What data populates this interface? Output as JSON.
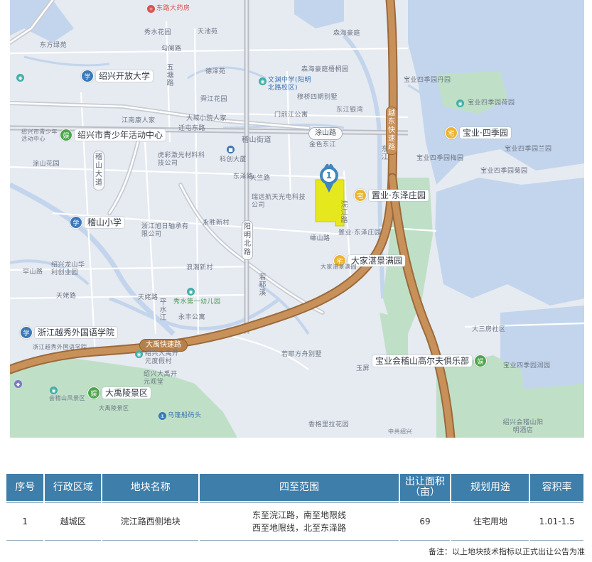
{
  "map": {
    "marker_number": "1",
    "colors": {
      "highway": "#b88049",
      "water": "#c3d5ec",
      "green": "#bfe0c7",
      "parcel": "#e6e81e",
      "marker": "#3f86bd"
    },
    "road_pills": {
      "tushan": "涂山路",
      "dayu": "大禹快速路"
    },
    "vertical_road_pills": {
      "yangming": "阳明北路",
      "yuedong": "越东快速路",
      "jishan": "稽山大道"
    },
    "poi": {
      "kaifang": {
        "icon": "education-icon",
        "text": "绍兴开放大学"
      },
      "youth": {
        "icon": "entertainment-icon",
        "text": "绍兴市青少年活动中心"
      },
      "baoye_siji": {
        "icon": "residential-icon",
        "text": "宝业·四季园"
      },
      "dongze": {
        "icon": "residential-icon",
        "text": "置业·东泽庄园"
      },
      "jishan_school": {
        "icon": "education-icon",
        "text": "稽山小学"
      },
      "dajia": {
        "icon": "residential-icon",
        "text": "大家湛景满园"
      },
      "yuexiu": {
        "icon": "education-icon",
        "text": "浙江越秀外国语学院"
      },
      "golf": {
        "icon": "entertainment-icon",
        "text": "宝业会稽山高尔夫俱乐部"
      },
      "dayuling": {
        "icon": "entertainment-icon",
        "text": "大禹陵景区"
      }
    },
    "labels": {
      "dongpu_pharmacy": "东路大药房",
      "xiuhuayuan": "秀水花园",
      "tianchi": "天池苑",
      "forest_sea": "森海豪庭",
      "dongfang": "东方绿苑",
      "goumei": "勾阑路",
      "wudi": "五塘路",
      "deze": "德泽苑",
      "wenyuan": "文渊中学(阳明北路校区)",
      "senhai_garden": "森海豪庭梧桐园",
      "muqiao": "穆桥四期别墅",
      "baoye_danyuan": "宝业四季园丹园",
      "shunjiang": "舜江花园",
      "menqian": "门前江公寓",
      "donglinyuan": "东江银湾",
      "jiangnan": "江南康人家",
      "dacheng": "大城小院人家",
      "qiantun": "迁屯东路",
      "jishan_street": "稽山街道",
      "jinhui": "金色东江",
      "baoye_hehuayuan": "宝业四季园荷园",
      "shaoxing_youth_small": "绍兴市青少年活动中心",
      "huzhen": "虎彩激光材料科技公司",
      "kechuang": "科创大厦",
      "tushan_garden": "涂山花园",
      "dongze_road": "东泽路",
      "baoye_lanyuan": "宝业四季园兰园",
      "baoye_meiyuan": "宝业四季园梅园",
      "baoye_juyuan": "宝业四季园菊园",
      "ruiyuan": "瑞远航天光电科技公司",
      "yongsheng": "永胜新村",
      "xuzi": "浙江旭日轴承有限公司",
      "huanjiang": "浣江路",
      "chenshan": "嵊山路",
      "baoye_dongze": "置业·东泽庄园",
      "dajia_small": "大家湛景满园",
      "jingshan": "罕山路",
      "shaoxing_longshan": "绍兴龙山华利创业园",
      "langchao": "浪潮新村",
      "tianshui": "天姥路",
      "tianzhu": "天姥路",
      "xiushui_park": "秀水第一幼儿园",
      "yongfeng": "永丰公寓",
      "dasanfang": "大三房社区",
      "xiuzhou_foreign_small": "浙江越秀外国语学院",
      "shaoxing_dayu": "绍兴大禹开元度假村",
      "ruofeng": "若耶方舟别墅",
      "jieshan_view": "会稽山风景区",
      "yuping": "玉屏",
      "baoye_runyuan": "宝业四季园润园",
      "shaoxing_kaiyuan": "绍兴大禹开元观堂",
      "dayuling_small": "大禹陵景区",
      "wupeng": "乌篷船码头",
      "xiangxiang": "香格里拉花园",
      "zhonggong": "中共绍兴",
      "shaoxing_jishan_hotel": "绍兴会稽山阳明酒店",
      "tianzhu2": "天竺路",
      "ruoyexi": "若耶溪",
      "pingshui": "平水江",
      "dongjiang": "东江"
    }
  },
  "table": {
    "headers": {
      "seq": "序号",
      "district": "行政区域",
      "name": "地块名称",
      "bounds": "四至范围",
      "area": "出让面积（亩）",
      "use": "规划用途",
      "far": "容积率"
    },
    "rows": [
      {
        "seq": "1",
        "district": "越城区",
        "name": "浣江路西侧地块",
        "bounds_line1": "东至浣江路，南至地限线",
        "bounds_line2": "西至地限线，北至东泽路",
        "area": "69",
        "use": "住宅用地",
        "far": "1.01-1.5"
      }
    ]
  },
  "footnote": "备注：以上地块技术指标以正式出让公告为准"
}
